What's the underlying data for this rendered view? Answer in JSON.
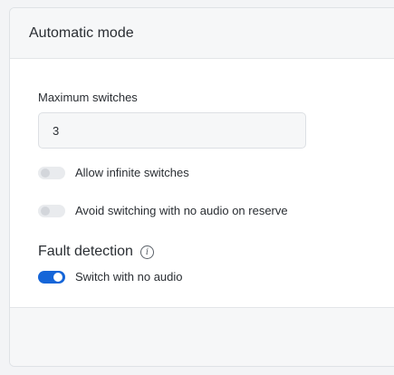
{
  "panel": {
    "title": "Automatic mode"
  },
  "max_switches": {
    "label": "Maximum switches",
    "value": "3"
  },
  "toggles": [
    {
      "label": "Allow infinite switches",
      "on": false
    },
    {
      "label": "Avoid switching with no audio on reserve",
      "on": false
    }
  ],
  "fault_detection": {
    "title": "Fault detection",
    "info_icon": "info-icon",
    "toggle": {
      "label": "Switch with no audio",
      "on": true
    }
  },
  "colors": {
    "accent": "#1565d8",
    "toggle_off_track": "#e9ebee",
    "toggle_off_knob": "#d3d6db"
  }
}
